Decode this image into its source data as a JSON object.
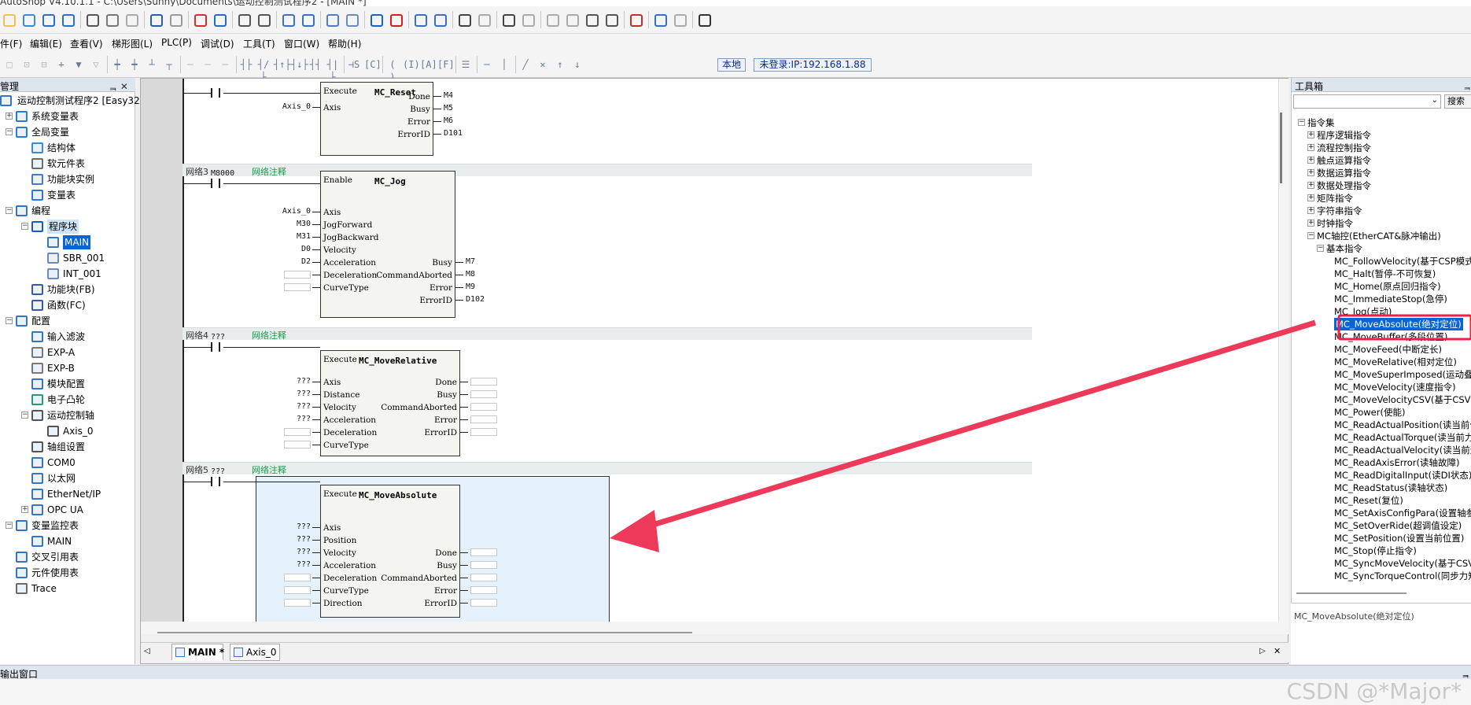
{
  "window": {
    "title": "AutoShop V4.10.1.1 - C:\\Users\\Sunny\\Documents\\运动控制测试程序2 - [MAIN *]"
  },
  "menu": [
    "件(F)",
    "编辑(E)",
    "查看(V)",
    "梯形图(L)",
    "PLC(P)",
    "调试(D)",
    "工具(T)",
    "窗口(W)",
    "帮助(H)"
  ],
  "toolbar2": {
    "local_label": "本地",
    "login_label": "未登录:IP:192.168.1.88"
  },
  "left_panel": {
    "title": "管理",
    "pin": "ᆿ ✕",
    "tree": [
      {
        "label": "运动控制测试程序2 [Easy32",
        "level": 0,
        "icon": "computer-icon"
      },
      {
        "label": "系统变量表",
        "level": 1,
        "icon": "globe-icon",
        "exp": "+"
      },
      {
        "label": "全局变量",
        "level": 1,
        "icon": "globe-icon",
        "exp": "-"
      },
      {
        "label": "结构体",
        "level": 2,
        "icon": "struct-icon"
      },
      {
        "label": "软元件表",
        "level": 2,
        "icon": "table-icon"
      },
      {
        "label": "功能块实例",
        "level": 2,
        "icon": "cube-icon"
      },
      {
        "label": "变量表",
        "level": 2,
        "icon": "globe-icon"
      },
      {
        "label": "编程",
        "level": 1,
        "icon": "program-icon",
        "exp": "-"
      },
      {
        "label": "程序块",
        "level": 2,
        "icon": "blocks-icon",
        "exp": "-",
        "style": "hl"
      },
      {
        "label": "MAIN",
        "level": 3,
        "icon": "main-doc-icon",
        "style": "sel"
      },
      {
        "label": "SBR_001",
        "level": 3,
        "icon": "doc-icon"
      },
      {
        "label": "INT_001",
        "level": 3,
        "icon": "doc-icon"
      },
      {
        "label": "功能块(FB)",
        "level": 2,
        "icon": "fb-icon"
      },
      {
        "label": "函数(FC)",
        "level": 2,
        "icon": "fc-icon"
      },
      {
        "label": "配置",
        "level": 1,
        "icon": "config-icon",
        "exp": "-"
      },
      {
        "label": "输入滤波",
        "level": 2,
        "icon": "filter-icon"
      },
      {
        "label": "EXP-A",
        "level": 2,
        "icon": "module-icon"
      },
      {
        "label": "EXP-B",
        "level": 2,
        "icon": "module-icon"
      },
      {
        "label": "模块配置",
        "level": 2,
        "icon": "module-config-icon"
      },
      {
        "label": "电子凸轮",
        "level": 2,
        "icon": "cam-icon"
      },
      {
        "label": "运动控制轴",
        "level": 2,
        "icon": "axis-icon",
        "exp": "-"
      },
      {
        "label": "Axis_0",
        "level": 3,
        "icon": "axis-item-icon"
      },
      {
        "label": "轴组设置",
        "level": 2,
        "icon": "gear-icon"
      },
      {
        "label": "COM0",
        "level": 2,
        "icon": "com-icon"
      },
      {
        "label": "以太网",
        "level": 2,
        "icon": "ethernet-icon"
      },
      {
        "label": "EtherNet/IP",
        "level": 2,
        "icon": "ethernetip-icon"
      },
      {
        "label": "OPC UA",
        "level": 2,
        "icon": "opcua-icon",
        "exp": "+"
      },
      {
        "label": "变量监控表",
        "level": 1,
        "icon": "monitor-icon",
        "exp": "-"
      },
      {
        "label": "MAIN",
        "level": 2,
        "icon": "monitor-doc-icon"
      },
      {
        "label": "交叉引用表",
        "level": 1,
        "icon": "crossref-icon"
      },
      {
        "label": "元件使用表",
        "level": 1,
        "icon": "usage-icon"
      },
      {
        "label": "Trace",
        "level": 1,
        "icon": "trace-icon"
      }
    ]
  },
  "networks": [
    {
      "fb_name": "MC_Reset",
      "enable": "Execute",
      "inputs": [
        {
          "pin": "Axis",
          "value": "Axis_0"
        }
      ],
      "outputs": [
        {
          "pin": "Done",
          "value": "M4"
        },
        {
          "pin": "Busy",
          "value": "M5"
        },
        {
          "pin": "Error",
          "value": "M6"
        },
        {
          "pin": "ErrorID",
          "value": "D101"
        }
      ]
    },
    {
      "id": "网络3",
      "comment": "网络注释",
      "contact": "M8000",
      "fb_name": "MC_Jog",
      "enable": "Enable",
      "inputs": [
        {
          "pin": "Axis",
          "value": "Axis_0"
        },
        {
          "pin": "JogForward",
          "value": "M30"
        },
        {
          "pin": "JogBackward",
          "value": "M31"
        },
        {
          "pin": "Velocity",
          "value": "D0"
        },
        {
          "pin": "Acceleration",
          "value": "D2"
        },
        {
          "pin": "Deceleration",
          "value": ""
        },
        {
          "pin": "CurveType",
          "value": ""
        }
      ],
      "outputs": [
        {
          "pin": "Busy",
          "value": "M7"
        },
        {
          "pin": "CommandAborted",
          "value": "M8"
        },
        {
          "pin": "Error",
          "value": "M9"
        },
        {
          "pin": "ErrorID",
          "value": "D102"
        }
      ]
    },
    {
      "id": "网络4",
      "comment": "网络注释",
      "contact": "???",
      "fb_name": "MC_MoveRelative",
      "enable": "Execute",
      "inputs": [
        {
          "pin": "Axis",
          "value": "???"
        },
        {
          "pin": "Distance",
          "value": "???"
        },
        {
          "pin": "Velocity",
          "value": "???"
        },
        {
          "pin": "Acceleration",
          "value": "???"
        },
        {
          "pin": "Deceleration",
          "value": ""
        },
        {
          "pin": "CurveType",
          "value": ""
        }
      ],
      "outputs": [
        {
          "pin": "Done",
          "value": ""
        },
        {
          "pin": "Busy",
          "value": ""
        },
        {
          "pin": "CommandAborted",
          "value": ""
        },
        {
          "pin": "Error",
          "value": ""
        },
        {
          "pin": "ErrorID",
          "value": ""
        }
      ]
    },
    {
      "id": "网络5",
      "comment": "网络注释",
      "contact": "???",
      "fb_name": "MC_MoveAbsolute",
      "enable": "Execute",
      "inputs": [
        {
          "pin": "Axis",
          "value": "???"
        },
        {
          "pin": "Position",
          "value": "???"
        },
        {
          "pin": "Velocity",
          "value": "???"
        },
        {
          "pin": "Acceleration",
          "value": "???"
        },
        {
          "pin": "Deceleration",
          "value": ""
        },
        {
          "pin": "CurveType",
          "value": ""
        },
        {
          "pin": "Direction",
          "value": ""
        }
      ],
      "outputs": [
        {
          "pin": "Done",
          "value": ""
        },
        {
          "pin": "Busy",
          "value": ""
        },
        {
          "pin": "CommandAborted",
          "value": ""
        },
        {
          "pin": "Error",
          "value": ""
        },
        {
          "pin": "ErrorID",
          "value": ""
        }
      ]
    }
  ],
  "editor_tabs": [
    {
      "label": "MAIN *",
      "active": true
    },
    {
      "label": "Axis_0",
      "active": false
    }
  ],
  "right_panel": {
    "title": "工具箱",
    "search_button": "搜索",
    "tree": [
      {
        "label": "指令集",
        "level": 0,
        "exp": "-"
      },
      {
        "label": "程序逻辑指令",
        "level": 1,
        "exp": "+"
      },
      {
        "label": "流程控制指令",
        "level": 1,
        "exp": "+"
      },
      {
        "label": "触点运算指令",
        "level": 1,
        "exp": "+"
      },
      {
        "label": "数据运算指令",
        "level": 1,
        "exp": "+"
      },
      {
        "label": "数据处理指令",
        "level": 1,
        "exp": "+"
      },
      {
        "label": "矩阵指令",
        "level": 1,
        "exp": "+"
      },
      {
        "label": "字符串指令",
        "level": 1,
        "exp": "+"
      },
      {
        "label": "时钟指令",
        "level": 1,
        "exp": "+"
      },
      {
        "label": "MC轴控(EtherCAT&脉冲输出)",
        "level": 1,
        "exp": "-"
      },
      {
        "label": "基本指令",
        "level": 2,
        "exp": "-"
      },
      {
        "label": "MC_FollowVelocity(基于CSP模式",
        "level": 3
      },
      {
        "label": "MC_Halt(暂停-不可恢复)",
        "level": 3
      },
      {
        "label": "MC_Home(原点回归指令)",
        "level": 3
      },
      {
        "label": "MC_ImmediateStop(急停)",
        "level": 3
      },
      {
        "label": "MC_Jog(点动)",
        "level": 3
      },
      {
        "label": "MC_MoveAbsolute(绝对定位)",
        "level": 3,
        "selected": true
      },
      {
        "label": "MC_MoveBuffer(多段位置)",
        "level": 3
      },
      {
        "label": "MC_MoveFeed(中断定长)",
        "level": 3
      },
      {
        "label": "MC_MoveRelative(相对定位)",
        "level": 3
      },
      {
        "label": "MC_MoveSuperImposed(运动叠加",
        "level": 3
      },
      {
        "label": "MC_MoveVelocity(速度指令)",
        "level": 3
      },
      {
        "label": "MC_MoveVelocityCSV(基于CSV,",
        "level": 3
      },
      {
        "label": "MC_Power(使能)",
        "level": 3
      },
      {
        "label": "MC_ReadActualPosition(读当前位",
        "level": 3
      },
      {
        "label": "MC_ReadActualTorque(读当前力",
        "level": 3
      },
      {
        "label": "MC_ReadActualVelocity(读当前速",
        "level": 3
      },
      {
        "label": "MC_ReadAxisError(读轴故障)",
        "level": 3
      },
      {
        "label": "MC_ReadDigitalInput(读DI状态)",
        "level": 3
      },
      {
        "label": "MC_ReadStatus(读轴状态)",
        "level": 3
      },
      {
        "label": "MC_Reset(复位)",
        "level": 3
      },
      {
        "label": "MC_SetAxisConfigPara(设置轴参",
        "level": 3
      },
      {
        "label": "MC_SetOverRide(超调值设定)",
        "level": 3
      },
      {
        "label": "MC_SetPosition(设置当前位置)",
        "level": 3
      },
      {
        "label": "MC_Stop(停止指令)",
        "level": 3
      },
      {
        "label": "MC_SyncMoveVelocity(基于CSV,",
        "level": 3
      },
      {
        "label": "MC_SyncTorqueControl(同步力矩",
        "level": 3
      }
    ],
    "footer_text": "MC_MoveAbsolute(绝对定位)"
  },
  "output_window": {
    "title": "输出窗口"
  },
  "watermark": "CSDN @*Major*"
}
